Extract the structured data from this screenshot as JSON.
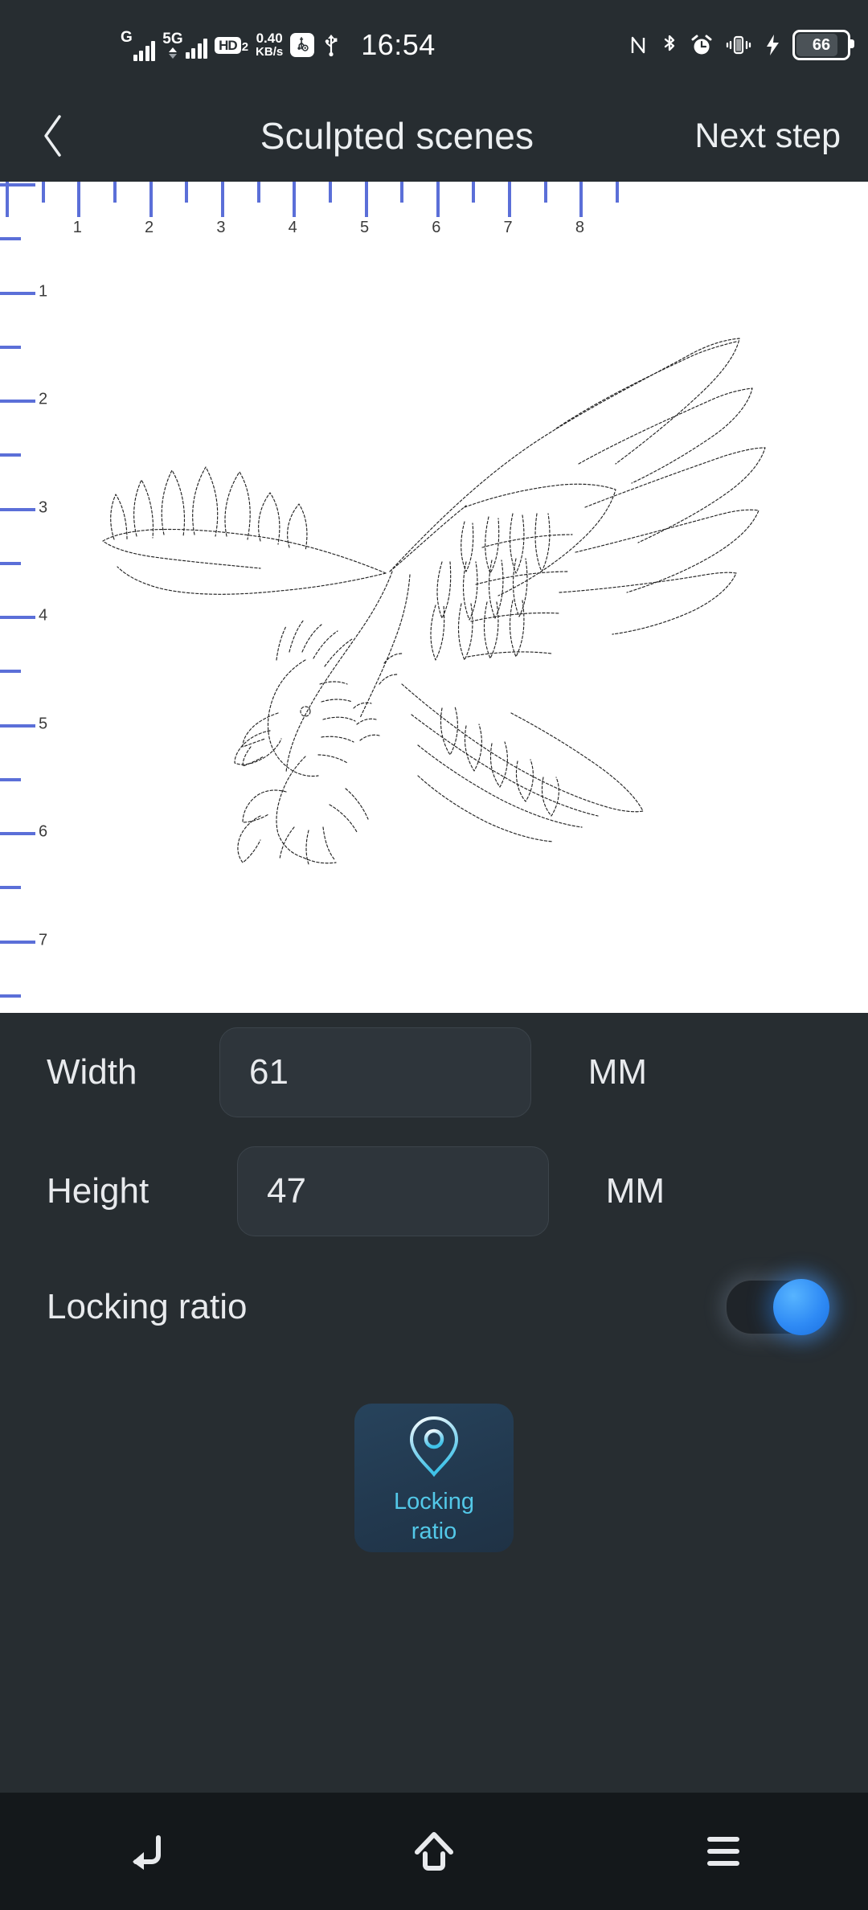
{
  "status_bar": {
    "network_1": {
      "icon": "signal-bars-icon",
      "label": "G"
    },
    "network_2": {
      "icon": "signal-bars-icon",
      "label": "5G"
    },
    "hd_voice": {
      "icon": "hd-voice-icon",
      "label": "HD",
      "sub": "2"
    },
    "net_speed": {
      "icon": "network-speed-icon",
      "value": "0.40",
      "unit": "KB/s"
    },
    "usb_debug": {
      "icon": "usb-debug-icon"
    },
    "usb": {
      "icon": "usb-icon"
    },
    "time": "16:54",
    "nfc": {
      "icon": "nfc-icon"
    },
    "bluetooth": {
      "icon": "bluetooth-icon"
    },
    "alarm": {
      "icon": "alarm-clock-icon"
    },
    "vibrate": {
      "icon": "vibrate-mode-icon"
    },
    "charging": {
      "icon": "charging-bolt-icon"
    },
    "battery": {
      "icon": "battery-icon",
      "level": "66"
    }
  },
  "header": {
    "back": {
      "icon": "chevron-left-icon"
    },
    "title": "Sculpted scenes",
    "next_step": "Next step"
  },
  "canvas": {
    "ruler_h_labels": [
      "1",
      "2",
      "3",
      "4",
      "5",
      "6",
      "7",
      "8"
    ],
    "ruler_v_labels": [
      "1",
      "2",
      "3",
      "4",
      "5",
      "6",
      "7"
    ],
    "artwork_name": "eagle-line-art"
  },
  "settings": {
    "width": {
      "label": "Width",
      "value": "61",
      "unit": "MM",
      "placeholder": "0"
    },
    "height": {
      "label": "Height",
      "value": "47",
      "unit": "MM",
      "placeholder": "0"
    },
    "locking_ratio": {
      "label": "Locking ratio",
      "enabled": "on"
    },
    "hint": {
      "icon": "location-pin-icon",
      "line1": "Locking",
      "line2": "ratio"
    }
  },
  "nav_bar": {
    "back": {
      "icon": "nav-back-icon"
    },
    "home": {
      "icon": "nav-home-icon"
    },
    "recents": {
      "icon": "nav-recents-icon"
    }
  },
  "colors": {
    "panel_bg": "#272d31",
    "canvas_bg": "#ffffff",
    "ruler_tick": "#5b6fd8",
    "accent_blue": "#2f8bf5",
    "hint_cyan": "#53c8e8",
    "nav_bg": "#14181b"
  }
}
